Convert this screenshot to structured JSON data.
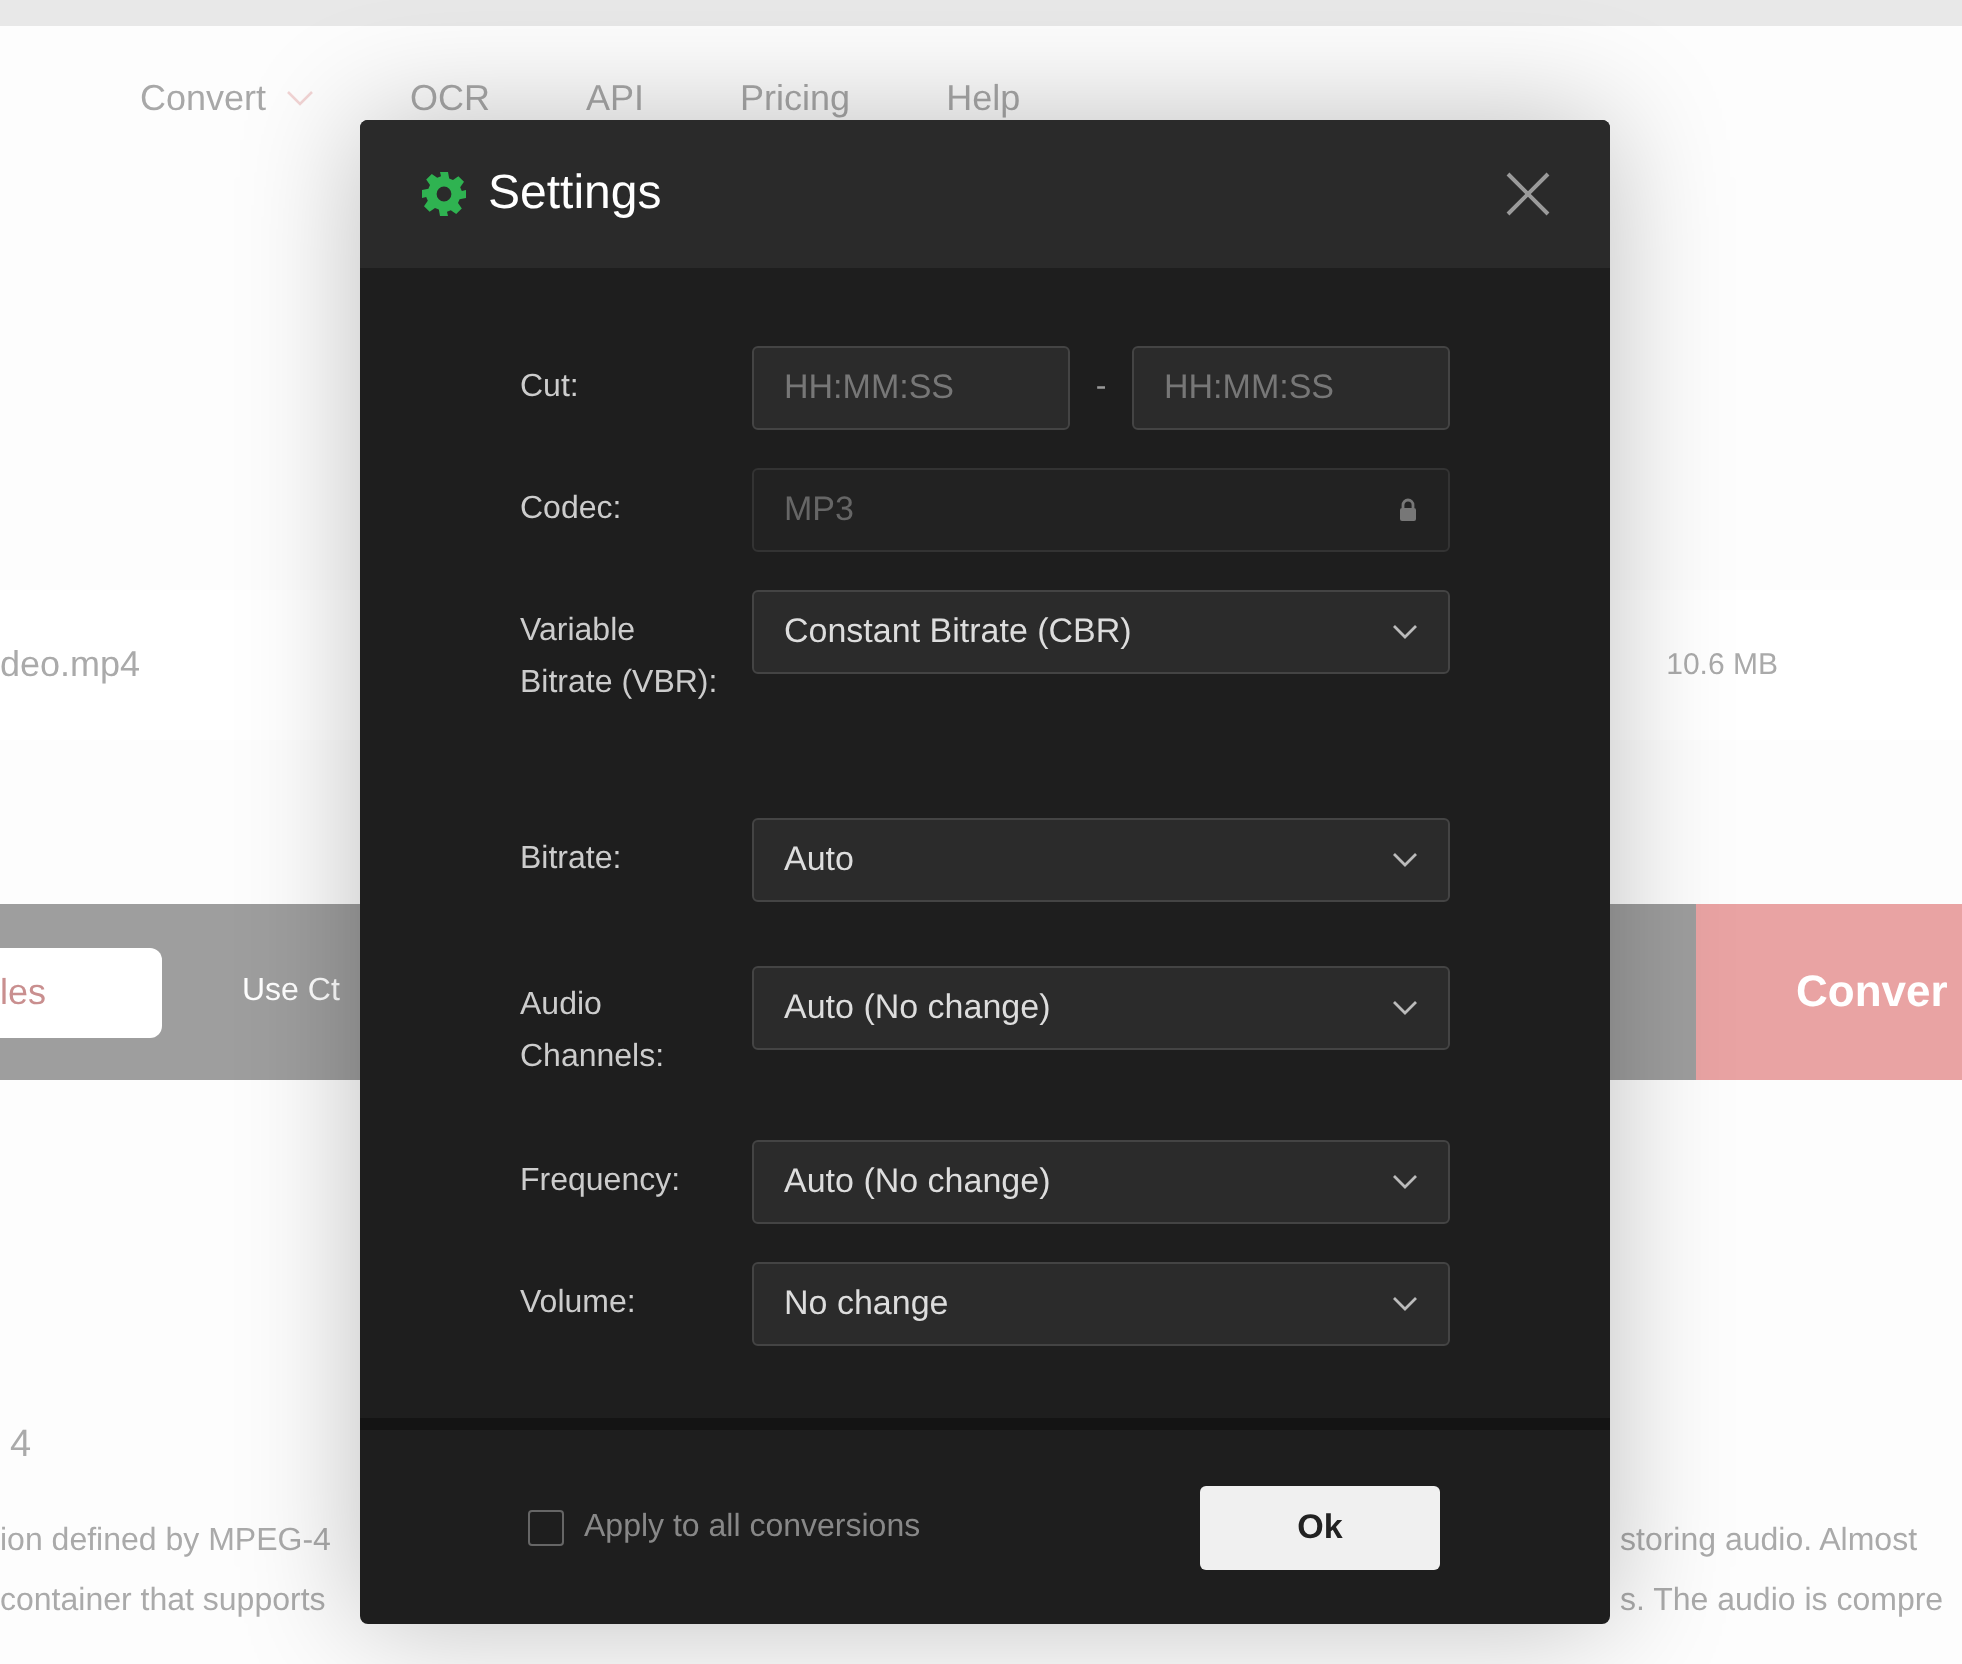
{
  "page": {
    "nav": [
      {
        "label": "Convert",
        "dropdown": true
      },
      {
        "label": "OCR",
        "dropdown": false
      },
      {
        "label": "API",
        "dropdown": false
      },
      {
        "label": "Pricing",
        "dropdown": false
      },
      {
        "label": "Help",
        "dropdown": false
      }
    ],
    "file": {
      "name": "deo.mp4",
      "size": "10.6 MB"
    },
    "toolbar": {
      "files_button": "les",
      "hint": "Use Ct",
      "convert_button": "Conver"
    },
    "heading": "4",
    "paragraph_left": [
      "ion defined by MPEG-4",
      "container that supports"
    ],
    "paragraph_right": [
      "storing audio. Almost",
      "s. The audio is compre"
    ]
  },
  "dialog": {
    "title": "Settings",
    "fields": [
      {
        "kind": "range",
        "label": "Cut:",
        "placeholder": "HH:MM:SS",
        "separator": "-",
        "placeholder_end": "HH:MM:SS"
      },
      {
        "kind": "locked",
        "label": "Codec:",
        "value": "MP3"
      },
      {
        "kind": "select",
        "label": "Variable Bitrate (VBR):",
        "value": "Constant Bitrate (CBR)"
      },
      {
        "kind": "select",
        "label": "Bitrate:",
        "value": "Auto"
      },
      {
        "kind": "select",
        "label": "Audio Channels:",
        "value": "Auto (No change)"
      },
      {
        "kind": "select",
        "label": "Frequency:",
        "value": "Auto (No change)"
      },
      {
        "kind": "select",
        "label": "Volume:",
        "value": "No change"
      }
    ],
    "apply_all": {
      "label": "Apply to all conversions",
      "checked": false
    },
    "ok_button": "Ok"
  }
}
